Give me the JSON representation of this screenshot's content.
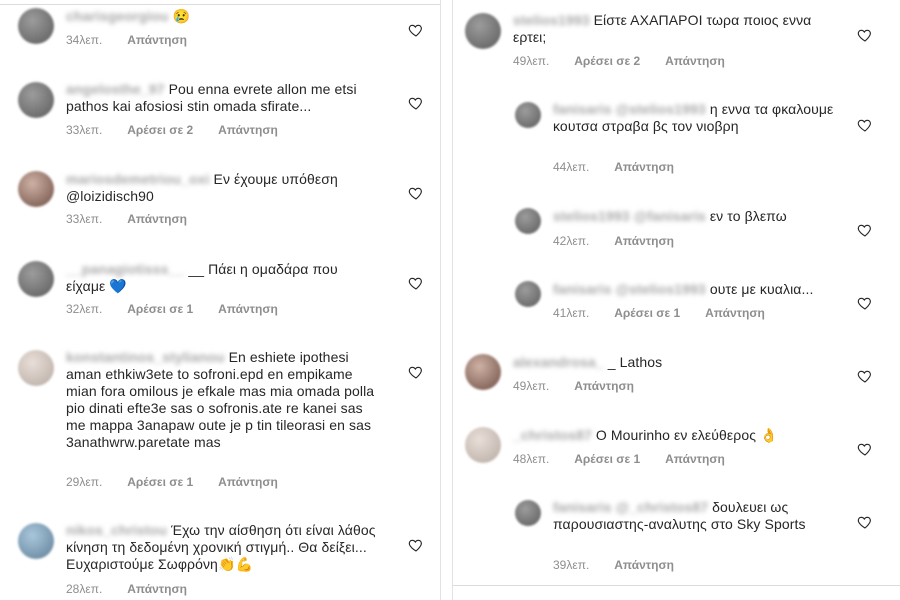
{
  "left": [
    {
      "username": "charisgeorgiou",
      "text": "😢",
      "time": "34λεπ.",
      "likes": "",
      "reply": "Απάντηση"
    },
    {
      "username": "angelosthe_97",
      "text": "Pou enna evrete allon me etsi pathos kai afosiosi stin omada sfirate...",
      "time": "33λεπ.",
      "likes": "Αρέσει σε 2",
      "reply": "Απάντηση"
    },
    {
      "username": "mariosdemetriou_oxi",
      "text": "Εν έχουμε υπόθεση @loizidisch90",
      "time": "33λεπ.",
      "likes": "",
      "reply": "Απάντηση"
    },
    {
      "username": "__panagiotisss__",
      "text": "__ Πάει η ομαδάρα που είχαμε 💙",
      "time": "32λεπ.",
      "likes": "Αρέσει σε 1",
      "reply": "Απάντηση"
    },
    {
      "username": "konstantinos_stylianou",
      "text": "En eshiete ipothesi aman ethkiw3ete to sofroni.epd en empikame mian fora omilous je efkale mas mia omada polla pio dinati efte3e sas o sofronis.ate re kanei sas me mappa 3anapaw oute je p tin tileorasi en sas 3anathwrw.paretate mas",
      "time": "29λεπ.",
      "likes": "Αρέσει σε 1",
      "reply": "Απάντηση"
    },
    {
      "username": "nikos_christou",
      "text": "Έχω την αίσθηση ότι είναι λάθος κίνηση τη δεδομένη χρονική στιγμή.. Θα δείξει... Ευχαριστούμε Σωφρόνη👏💪",
      "time": "28λεπ.",
      "likes": "",
      "reply": "Απάντηση"
    }
  ],
  "right": [
    {
      "username": "stelios1993",
      "text": "Είστε ΑΧΑΠΑΡΟΙ τωρα ποιος εννα ερτει;",
      "time": "49λεπ.",
      "likes": "Αρέσει σε 2",
      "reply": "Απάντηση"
    },
    {
      "username": "fanisaris @stelios1993",
      "text": "η εννα τα φκαλουμε κουτσα στραβα βς τον νιοβρη",
      "time": "44λεπ.",
      "likes": "",
      "reply": "Απάντηση"
    },
    {
      "username": "stelios1993 @fanisaris",
      "text": "εν το βλεπω",
      "time": "42λεπ.",
      "likes": "",
      "reply": "Απάντηση"
    },
    {
      "username": "fanisaris @stelios1993",
      "text": "ουτε με κυαλια...",
      "time": "41λεπ.",
      "likes": "Αρέσει σε 1",
      "reply": "Απάντηση"
    },
    {
      "username": "alexandrosa_",
      "text": "_ Lathos",
      "time": "49λεπ.",
      "likes": "",
      "reply": "Απάντηση"
    },
    {
      "username": "_christos87",
      "text": "Ο Mourinho εν ελεύθερος 👌",
      "time": "48λεπ.",
      "likes": "Αρέσει σε 1",
      "reply": "Απάντηση"
    },
    {
      "username": "fanisaris @_christos87",
      "text": "δουλευει ως παρουσιαστης-αναλυτης στο Sky Sports",
      "time": "39λεπ.",
      "likes": "",
      "reply": "Απάντηση"
    }
  ]
}
